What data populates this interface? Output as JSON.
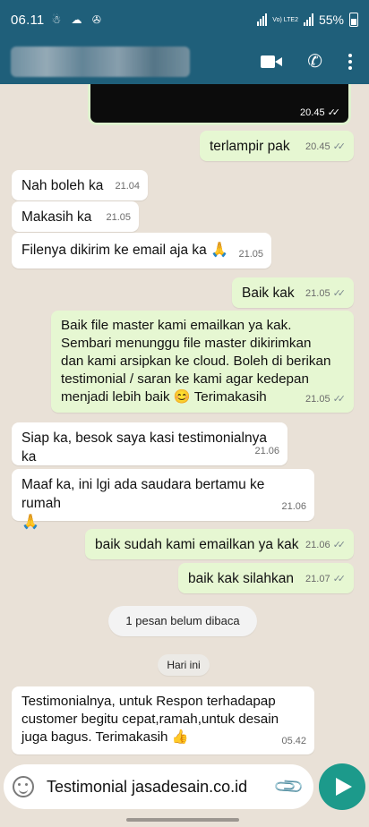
{
  "status_bar": {
    "time": "06.11",
    "icons": "☃ ☁ ✇",
    "network": "Vo) LTE2",
    "battery": "55%"
  },
  "header": {
    "contact_name_redacted": "",
    "actions": [
      "video-call-icon",
      "phone-icon",
      "more-icon"
    ]
  },
  "messages": [
    {
      "dir": "out",
      "type": "media",
      "time": "20.45",
      "status": "read"
    },
    {
      "dir": "out",
      "text": "terlampir pak",
      "time": "20.45",
      "status": "read"
    },
    {
      "dir": "in",
      "text": "Nah boleh ka",
      "time": "21.04"
    },
    {
      "dir": "in",
      "text": "Makasih ka",
      "time": "21.05"
    },
    {
      "dir": "in",
      "text": "Filenya dikirim ke email aja ka",
      "emoji": "🙏",
      "time": "21.05"
    },
    {
      "dir": "out",
      "text": "Baik kak",
      "time": "21.05",
      "status": "read"
    },
    {
      "dir": "out",
      "line1": "Baik file master kami emailkan ya kak.",
      "line2": "Sembari menunggu file master dikirimkan",
      "line3": "dan kami arsipkan ke cloud. Boleh di berikan",
      "line4": "testimonial / saran ke kami agar kedepan",
      "line5": "menjadi lebih baik",
      "emoji": "😊",
      "line5b": "Terimakasih",
      "time": "21.05",
      "status": "read"
    },
    {
      "dir": "in",
      "text": "Siap ka, besok saya kasi testimonialnya ka",
      "time": "21.06"
    },
    {
      "dir": "in",
      "text": "Maaf ka, ini lgi ada saudara bertamu ke rumah",
      "emoji": "🙏",
      "time": "21.06"
    },
    {
      "dir": "out",
      "text": "baik sudah kami emailkan ya kak",
      "time": "21.06",
      "status": "read"
    },
    {
      "dir": "out",
      "text": "baik kak silahkan",
      "time": "21.07",
      "status": "read"
    },
    {
      "dir": "in",
      "line1": "Testimonialnya, untuk Respon terhadapap",
      "line2": "customer begitu cepat,ramah,untuk desain",
      "line3": "juga bagus. Terimakasih",
      "emoji": "👍",
      "time": "05.42"
    }
  ],
  "unread_banner": "1 pesan belum dibaca",
  "date_chip": "Hari ini",
  "composer": {
    "value": "Testimonial jasadesain.co.id",
    "icons": [
      "emoji-icon",
      "attach-icon",
      "send-icon"
    ]
  },
  "colors": {
    "header_bg": "#1f5f7a",
    "chat_bg": "#e9e1d7",
    "outgoing_bubble": "#e6f7d2",
    "incoming_bubble": "#ffffff",
    "send_button": "#1c9a8b"
  }
}
